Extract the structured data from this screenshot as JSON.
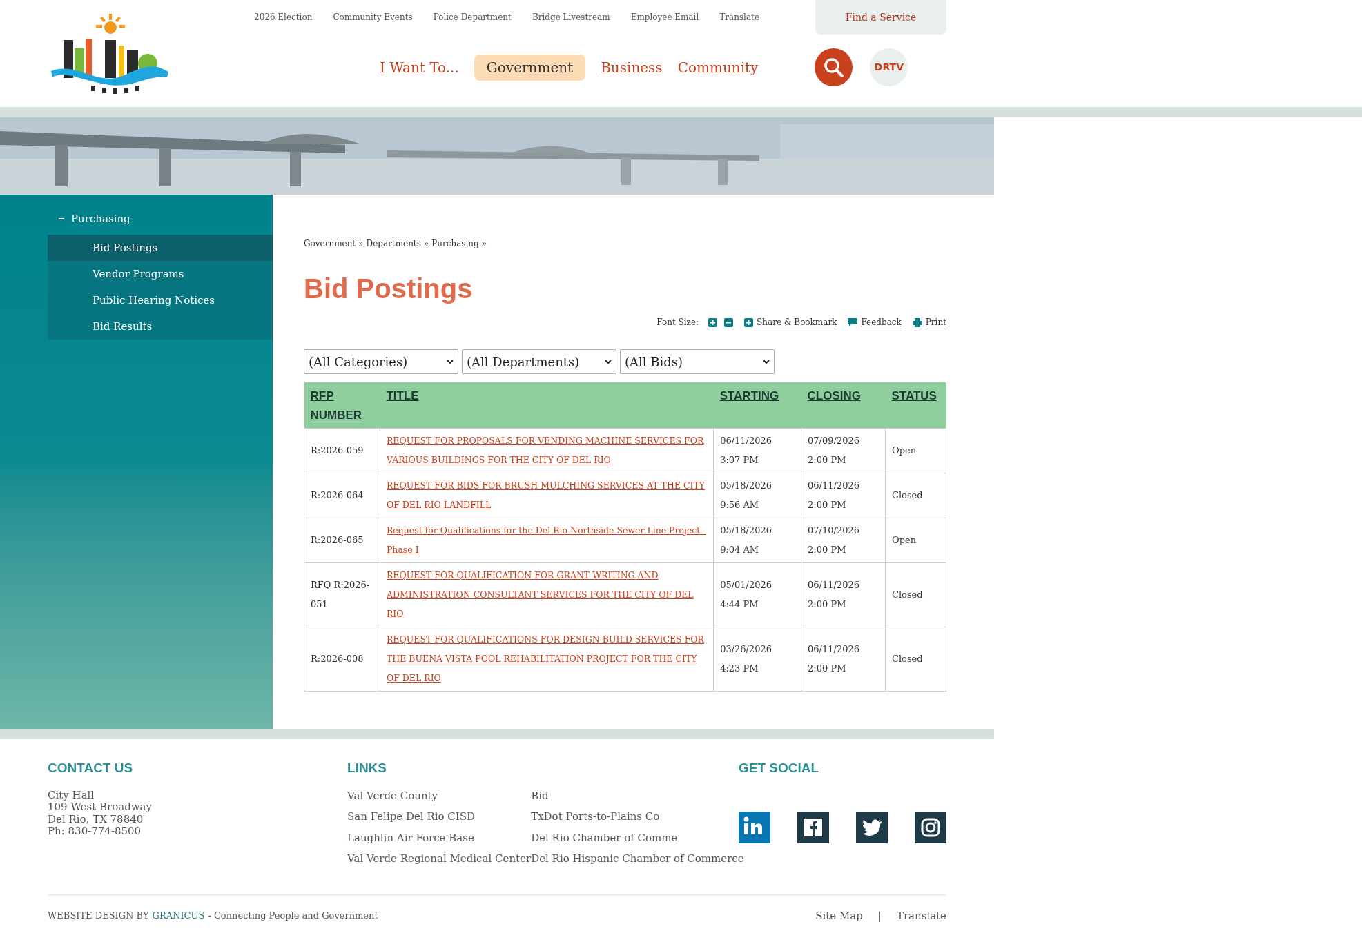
{
  "top_links": [
    "2026 Election",
    "Community Events",
    "Police Department",
    "Bridge Livestream",
    "Employee Email",
    "Translate"
  ],
  "find_service": "Find a Service",
  "nav": [
    {
      "label": "I Want To...",
      "selected": false
    },
    {
      "label": "Government",
      "selected": true
    },
    {
      "label": "Business",
      "selected": false
    },
    {
      "label": "Community",
      "selected": false
    }
  ],
  "drtv": "DRTV",
  "sidebar": {
    "parent": {
      "label": "Purchasing",
      "expanded": true,
      "children": [
        {
          "label": "Bid Postings",
          "selected": true
        },
        {
          "label": "Vendor Programs",
          "selected": false
        },
        {
          "label": "Public Hearing Notices",
          "selected": false
        },
        {
          "label": "Bid Results",
          "selected": false
        }
      ]
    }
  },
  "breadcrumb": [
    "Government",
    "Departments",
    "Purchasing"
  ],
  "breadcrumb_separator": "»",
  "page_title": "Bid Postings",
  "tools": {
    "font_size_label": "Font Size:",
    "links": [
      {
        "kind": "share",
        "label": "Share & Bookmark"
      },
      {
        "kind": "feedback",
        "label": "Feedback"
      },
      {
        "kind": "print",
        "label": "Print"
      }
    ]
  },
  "filters": [
    "(All Categories)",
    "(All Departments)",
    "(All Bids)"
  ],
  "table": {
    "columns": [
      "RFP NUMBER",
      "TITLE",
      "STARTING",
      "CLOSING",
      "STATUS"
    ],
    "rows": [
      {
        "number": "R:2026-059",
        "title": "REQUEST FOR PROPOSALS FOR VENDING MACHINE SERVICES FOR VARIOUS BUILDINGS FOR THE CITY OF DEL RIO",
        "starting": [
          "06/11/2026",
          "3:07 PM"
        ],
        "closing": [
          "07/09/2026",
          "2:00 PM"
        ],
        "status": "Open"
      },
      {
        "number": "R:2026-064",
        "title": "REQUEST FOR BIDS FOR BRUSH MULCHING SERVICES AT THE CITY OF DEL RIO LANDFILL",
        "starting": [
          "05/18/2026",
          "9:56 AM"
        ],
        "closing": [
          "06/11/2026",
          "2:00 PM"
        ],
        "status": "Closed"
      },
      {
        "number": "R:2026-065",
        "title": "Request for Qualifications for the Del Rio Northside Sewer Line Project - Phase I",
        "starting": [
          "05/18/2026",
          "9:04 AM"
        ],
        "closing": [
          "07/10/2026",
          "2:00 PM"
        ],
        "status": "Open"
      },
      {
        "number": "RFQ R:2026-051",
        "title": "REQUEST FOR QUALIFICATION FOR GRANT WRITING AND ADMINISTRATION CONSULTANT SERVICES FOR THE CITY OF DEL RIO",
        "starting": [
          "05/01/2026",
          "4:44 PM"
        ],
        "closing": [
          "06/11/2026",
          "2:00 PM"
        ],
        "status": "Closed"
      },
      {
        "number": "R:2026-008",
        "title": "REQUEST FOR QUALIFICATIONS FOR DESIGN-BUILD SERVICES FOR THE BUENA VISTA POOL REHABILITATION PROJECT FOR THE CITY OF DEL RIO",
        "starting": [
          "03/26/2026",
          "4:23 PM"
        ],
        "closing": [
          "06/11/2026",
          "2:00 PM"
        ],
        "status": "Closed"
      }
    ]
  },
  "footer": {
    "contact": {
      "heading": "CONTACT US",
      "lines": [
        "City Hall",
        "109 West Broadway",
        "Del Rio, TX 78840",
        "Ph: 830-774-8500"
      ]
    },
    "links": {
      "heading": "LINKS",
      "column_1": [
        "Val Verde County",
        "San Felipe Del Rio CISD",
        "Laughlin Air Force Base",
        "Val Verde Regional Medical Center"
      ],
      "column_2": [
        "Bid",
        "TxDot Ports-to-Plains Co",
        "Del Rio Chamber of Comme",
        "Del Rio Hispanic Chamber of Commerce"
      ]
    },
    "social": {
      "heading": "GET SOCIAL",
      "icons": [
        {
          "kind": "linkedin"
        },
        {
          "kind": "facebook"
        },
        {
          "kind": "twitter"
        },
        {
          "kind": "instagram"
        }
      ]
    },
    "credit": {
      "prefix": "WEBSITE DESIGN BY",
      "brand": "GRANICUS",
      "suffix": "- Connecting People and Government"
    },
    "bottom_links": [
      "Site Map",
      "Translate"
    ],
    "bottom_separator": "|"
  }
}
